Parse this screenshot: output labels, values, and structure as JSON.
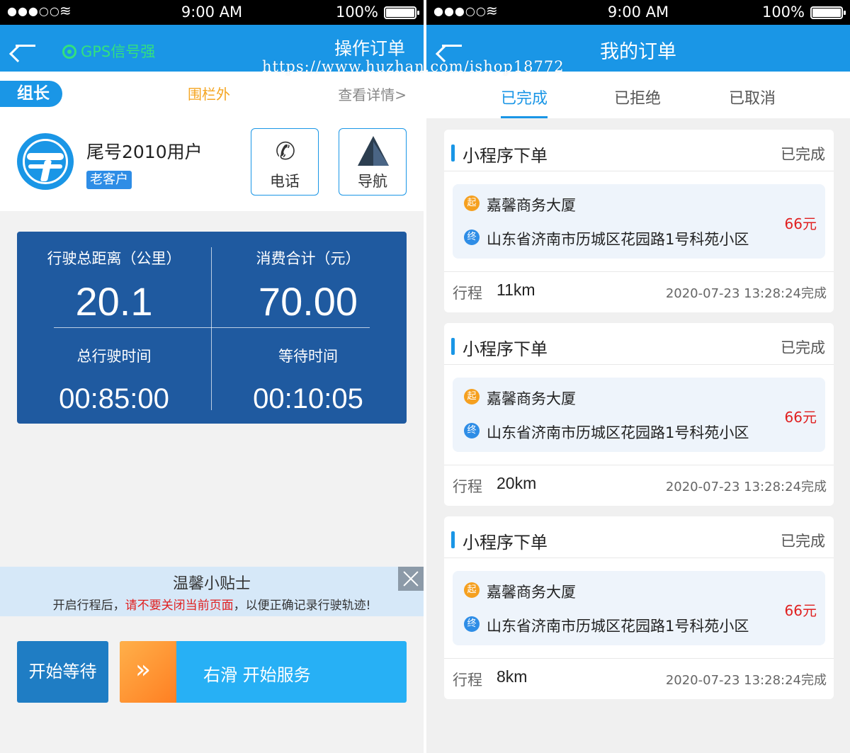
{
  "status": {
    "time": "9:00 AM",
    "battery": "100%",
    "signal": "●●●○○"
  },
  "left": {
    "gps_label": "GPS信号强",
    "nav_action": "操作订单",
    "role_badge": "组长",
    "fence_status": "围栏外",
    "view_detail": "查看详情>",
    "customer": {
      "name": "尾号2010用户",
      "tag": "老客户"
    },
    "actions": {
      "phone": "电话",
      "navigate": "导航"
    },
    "stats": {
      "distance_label": "行驶总距离（公里）",
      "distance_value": "20.1",
      "cost_label": "消费合计（元）",
      "cost_value": "70.00",
      "drive_time_label": "总行驶时间",
      "drive_time_value": "00:85:00",
      "wait_time_label": "等待时间",
      "wait_time_value": "00:10:05"
    },
    "tip": {
      "title": "温馨小贴士",
      "body_prefix": "开启行程后，",
      "body_warning": "请不要关闭当前页面",
      "body_suffix": "，以便正确记录行驶轨迹!"
    },
    "wait_button": "开始等待",
    "slide_label": "右滑  开始服务"
  },
  "watermark": "https://www.huzhan.com/ishop18772",
  "right": {
    "title": "我的订单",
    "tabs": [
      "已完成",
      "已拒绝",
      "已取消"
    ],
    "active_tab": "已完成",
    "orders": [
      {
        "type": "小程序下单",
        "status": "已完成",
        "start_mark": "起",
        "end_mark": "终",
        "from": "嘉馨商务大厦",
        "to": "山东省济南市历城区花园路1号科苑小区",
        "price": "66元",
        "trip_label": "行程",
        "trip": "11km",
        "completed": "2020-07-23 13:28:24完成"
      },
      {
        "type": "小程序下单",
        "status": "已完成",
        "start_mark": "起",
        "end_mark": "终",
        "from": "嘉馨商务大厦",
        "to": "山东省济南市历城区花园路1号科苑小区",
        "price": "66元",
        "trip_label": "行程",
        "trip": "20km",
        "completed": "2020-07-23 13:28:24完成"
      },
      {
        "type": "小程序下单",
        "status": "已完成",
        "start_mark": "起",
        "end_mark": "终",
        "from": "嘉馨商务大厦",
        "to": "山东省济南市历城区花园路1号科苑小区",
        "price": "66元",
        "trip_label": "行程",
        "trip": "8km",
        "completed": "2020-07-23 13:28:24完成"
      }
    ]
  },
  "colors": {
    "primary": "#1a96e6",
    "stats_bg": "#1f5aa0",
    "accent_orange": "#f5a623",
    "price_red": "#e02020",
    "gps_green": "#32e07f"
  },
  "icons": {
    "back": "back-arrow-icon",
    "gps": "gps-signal-icon",
    "phone": "phone-icon",
    "navigate": "navigation-arrow-icon",
    "close": "close-icon",
    "slide": "double-chevron-right-icon"
  }
}
